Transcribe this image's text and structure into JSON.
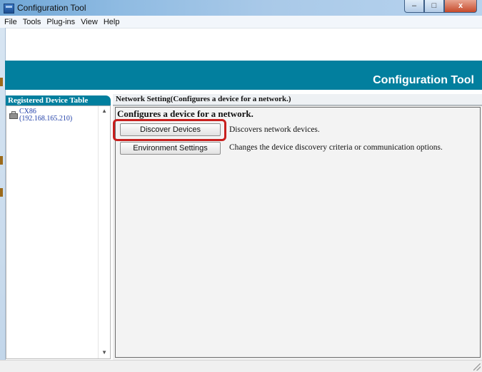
{
  "window": {
    "title": "Configuration Tool",
    "controls": {
      "minimize": "–",
      "maximize": "□",
      "close": "x"
    }
  },
  "menu": [
    "File",
    "Tools",
    "Plug-ins",
    "View",
    "Help"
  ],
  "banner": {
    "title": "Configuration Tool",
    "color": "#027f9e"
  },
  "left_panel": {
    "tab_label": "Registered Device Table",
    "devices": [
      {
        "name": "CX86",
        "ip": "(192.168.165.210)",
        "icon": "printer-icon"
      }
    ]
  },
  "right_panel": {
    "tab_label": "Network Setting(Configures a device for a network.)",
    "heading": "Configures a device for a network.",
    "actions": [
      {
        "label": "Discover Devices",
        "description": "Discovers network devices.",
        "highlighted": true
      },
      {
        "label": "Environment Settings",
        "description": "Changes the device discovery criteria or communication options.",
        "highlighted": false
      }
    ]
  },
  "colors": {
    "highlight": "#c8201e",
    "accent": "#027f9e"
  }
}
